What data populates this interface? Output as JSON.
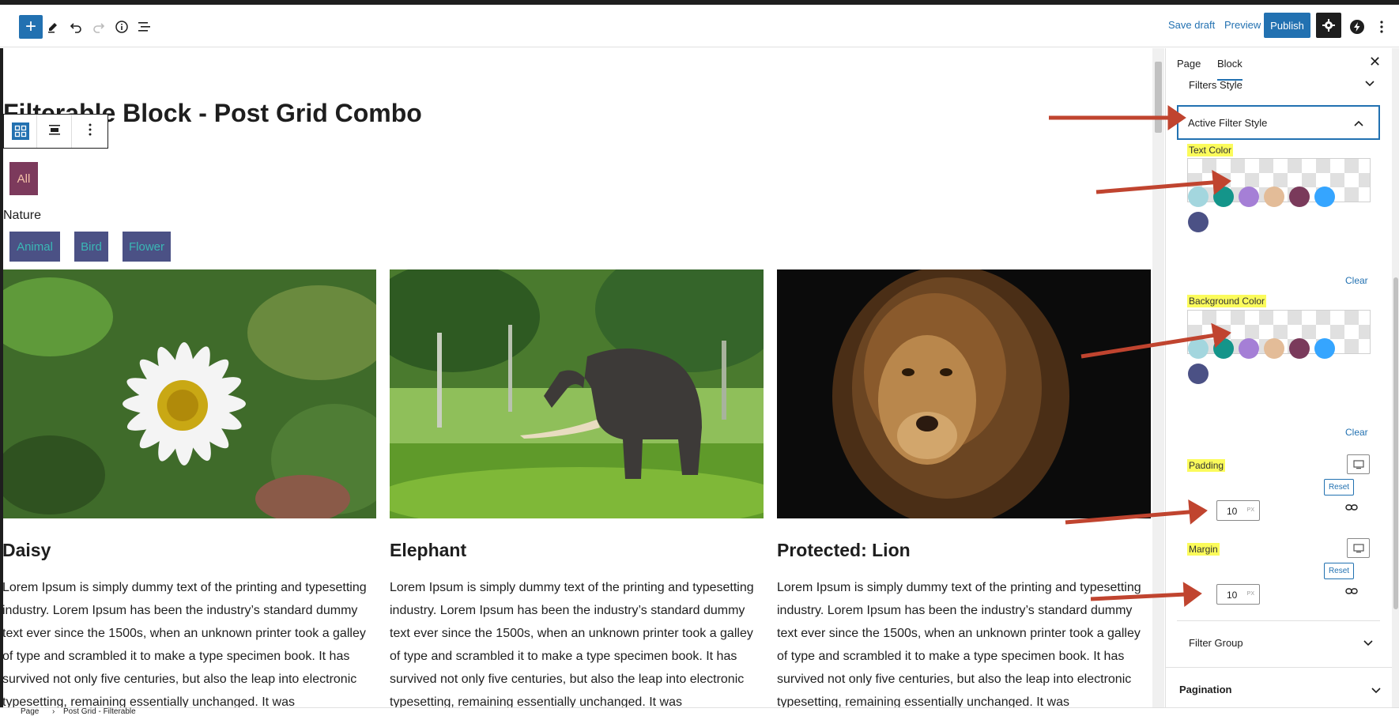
{
  "toolbar": {
    "add_label": "+",
    "save_draft": "Save draft",
    "preview": "Preview",
    "publish": "Publish"
  },
  "editor": {
    "page_title": "Filterable Block - Post Grid Combo",
    "filter_all": "All",
    "group_label": "Nature",
    "filters": [
      "Animal",
      "Bird",
      "Flower"
    ],
    "cards": [
      {
        "title": "Daisy",
        "text": "Lorem Ipsum is simply dummy text of the printing and typesetting industry. Lorem Ipsum has been the industry’s standard dummy text ever since the 1500s, when an unknown printer took a galley of type and scrambled it to make a type specimen book. It has survived not only five centuries, but also the leap into electronic typesetting, remaining essentially unchanged. It was"
      },
      {
        "title": "Elephant",
        "text": "Lorem Ipsum is simply dummy text of the printing and typesetting industry. Lorem Ipsum has been the industry’s standard dummy text ever since the 1500s, when an unknown printer took a galley of type and scrambled it to make a type specimen book. It has survived not only five centuries, but also the leap into electronic typesetting, remaining essentially unchanged. It was"
      },
      {
        "title": "Protected: Lion",
        "text": "Lorem Ipsum is simply dummy text of the printing and typesetting industry. Lorem Ipsum has been the industry’s standard dummy text ever since the 1500s, when an unknown printer took a galley of type and scrambled it to make a type specimen book. It has survived not only five centuries, but also the leap into electronic typesetting, remaining essentially unchanged. It was"
      }
    ],
    "colors": {
      "all_bg": "#7c3a5c",
      "all_fg": "#f5c2a8",
      "chip_bg": "#4b5185",
      "chip_fg": "#3ab7b5"
    }
  },
  "sidebar": {
    "tab_page": "Page",
    "tab_block": "Block",
    "close": "✕",
    "filters_style": "Filters Style",
    "active_filter_style": "Active Filter Style",
    "text_color_label": "Text Color",
    "background_color_label": "Background Color",
    "clear": "Clear",
    "padding_label": "Padding",
    "margin_label": "Margin",
    "reset": "Reset",
    "padding_value": "10",
    "margin_value": "10",
    "unit": "PX",
    "filter_group": "Filter Group",
    "pagination": "Pagination",
    "palette": [
      "#a3d6de",
      "#14958a",
      "#a57fd6",
      "#e3bc98",
      "#7a3a5b",
      "#35a5ff",
      "#4b5185"
    ]
  },
  "breadcrumb": {
    "items": [
      "Page",
      "Post Grid - Filterable"
    ],
    "separator": "›"
  },
  "annotation_color": "#c0442f"
}
